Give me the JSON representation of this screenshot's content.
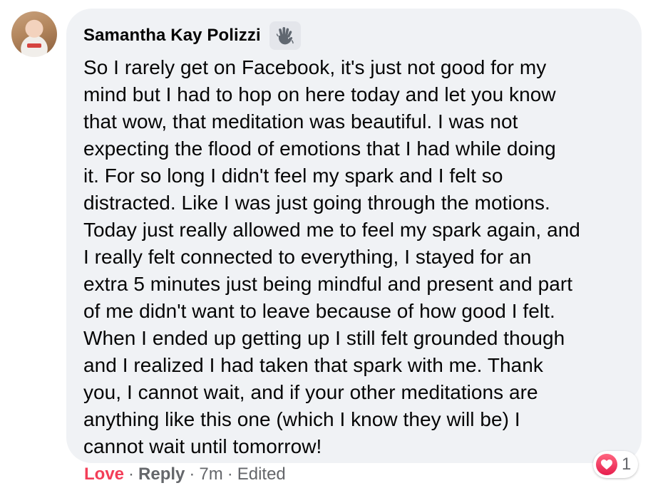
{
  "comment": {
    "author": "Samantha Kay Polizzi",
    "badge_icon": "wave-hand-icon",
    "text": "So I rarely get on Facebook, it's just not good for my\nmind but I had to hop on here today and let you know\nthat wow, that meditation was beautiful. I was not\nexpecting the flood of emotions that I had while doing\nit. For so long I didn't feel my spark and I felt so\ndistracted. Like I was just going through the motions.\nToday just really allowed me to feel my spark again, and\nI really felt connected to everything, I stayed for an\nextra 5 minutes just being mindful and present and part\nof me didn't want to leave because of how good I felt.\nWhen I ended up getting up I still felt grounded though\nand I realized I had taken that spark with me. Thank\nyou, I cannot wait, and if your other meditations are\nanything like this one (which I know they will be) I\ncannot wait until tomorrow!"
  },
  "reaction": {
    "icon": "heart-icon",
    "count": "1",
    "color": "#f33e58"
  },
  "actions": {
    "love_label": "Love",
    "separator": "·",
    "reply_label": "Reply",
    "time": "7m",
    "edited": "Edited"
  },
  "colors": {
    "bubble_bg": "#f0f2f5",
    "text": "#050505",
    "muted": "#65676b",
    "love": "#f33e58"
  }
}
